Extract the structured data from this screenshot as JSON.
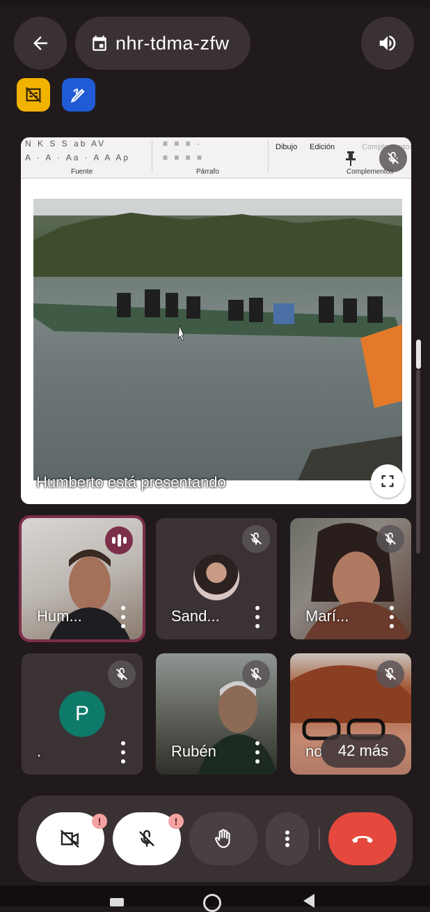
{
  "meeting": {
    "code": "nhr-tdma-zfw",
    "presenting_label": "Humberto está presentando"
  },
  "icons": {
    "back": "arrow-back-icon",
    "calendar": "calendar-icon",
    "speaker": "volume-icon",
    "no_captions_chip": "captions-off-icon",
    "whiteboard_chip": "edit-pencil-icon",
    "fullscreen": "fullscreen-icon",
    "mic_off": "mic-off-icon",
    "speaking": "audio-level-icon",
    "pin": "pin-icon"
  },
  "presentation": {
    "ribbon": {
      "groups": [
        "Fuente",
        "Párrafo",
        "Complementos"
      ],
      "buttons": [
        "Dibujo",
        "Edición",
        "Complementos"
      ]
    }
  },
  "participants": [
    {
      "name": "Hum...",
      "speaking": true,
      "muted": false,
      "tile": "video"
    },
    {
      "name": "Sand...",
      "speaking": false,
      "muted": true,
      "tile": "avatar-photo"
    },
    {
      "name": "Marí...",
      "speaking": false,
      "muted": true,
      "tile": "video"
    },
    {
      "name": ".",
      "initial": "P",
      "speaking": false,
      "muted": true,
      "tile": "avatar-initial"
    },
    {
      "name": "Rubén",
      "speaking": false,
      "muted": true,
      "tile": "video"
    },
    {
      "name": "no",
      "speaking": false,
      "muted": true,
      "tile": "video",
      "more_count": "42 más"
    }
  ],
  "controls": {
    "camera": {
      "icon": "videocam-off-icon",
      "alert": "!"
    },
    "mic": {
      "icon": "mic-off-icon",
      "alert": "!"
    },
    "raise_hand": {
      "icon": "hand-icon"
    },
    "more": {
      "icon": "more-vert-icon"
    },
    "hangup": {
      "icon": "call-end-icon"
    }
  },
  "colors": {
    "background": "#211a1c",
    "surface": "#3a3133",
    "speaking_accent": "#7c2f4a",
    "hangup": "#e5483d",
    "chip_yellow": "#f2b200",
    "chip_blue": "#1f5bd6",
    "avatar_teal": "#0e7a6a"
  }
}
